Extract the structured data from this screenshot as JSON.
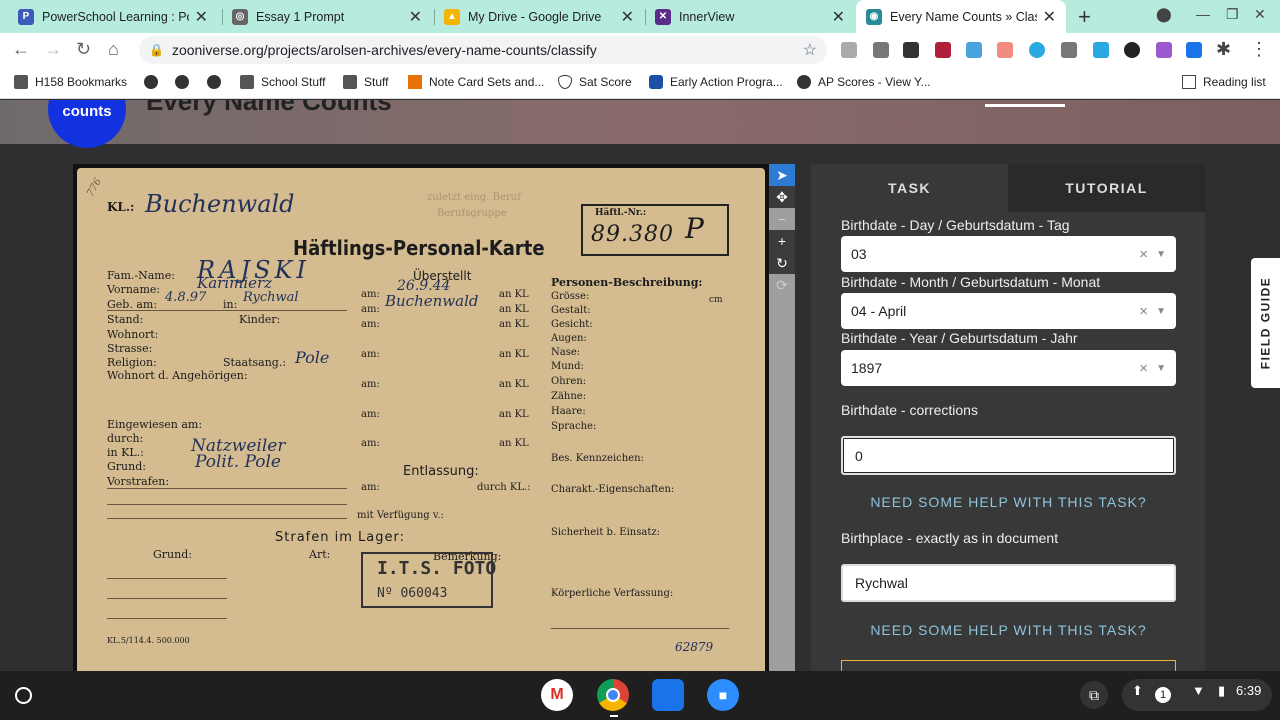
{
  "tabs": [
    {
      "title": "PowerSchool Learning : Port",
      "color": "#3b5bb8",
      "glyph": "P"
    },
    {
      "title": "Essay 1 Prompt",
      "color": "#666",
      "glyph": "◎"
    },
    {
      "title": "My Drive - Google Drive",
      "color": "#f4b400",
      "glyph": "▲"
    },
    {
      "title": "InnerView",
      "color": "#5b2c87",
      "glyph": "✕"
    },
    {
      "title": "Every Name Counts » Classi",
      "color": "#2a8a9a",
      "glyph": "◉"
    }
  ],
  "url": "zooniverse.org/projects/arolsen-archives/every-name-counts/classify",
  "bookmarks": [
    "H158 Bookmarks",
    "",
    "",
    "",
    "School Stuff",
    "Stuff",
    "Note Card Sets and...",
    "Sat Score",
    "Early Action Progra...",
    "AP Scores - View Y..."
  ],
  "reading_list": "Reading list",
  "site": {
    "logo_text": "counts",
    "title": "Every Name Counts"
  },
  "card": {
    "corner": "776",
    "kl_label": "KL.:",
    "kl_value": "Buchenwald",
    "hno_label": "Häftl.-Nr.:",
    "hno_value": "89.380",
    "hno_mark": "P",
    "title": "Häftlings-Personal-Karte",
    "faded_top": "zuletzt eing. Beruf",
    "faded_top2": "Berufsgruppe",
    "ueberstellt": "Überstellt",
    "personen": "Personen-Beschreibung:",
    "fam_label": "Fam.-Name:",
    "fam_value": "RAJSKI",
    "vor_label": "Vorname:",
    "vor_value": "Karimierz",
    "geb_label": "Geb. am:",
    "geb_value": "4.8.97",
    "in_label": "in:",
    "in_value": "Rychwal",
    "stand": "Stand:",
    "kinder": "Kinder:",
    "wohnort": "Wohnort:",
    "strasse": "Strasse:",
    "religion": "Religion:",
    "staatsang": "Staatsang.:",
    "staatsang_value": "Pole",
    "wohnort_ang": "Wohnort d. Angehörigen:",
    "am1_value": "26.9.44",
    "am_kl1_value": "Buchenwald",
    "am": "am:",
    "an_kl": "an KL",
    "groesse": "Grösse:",
    "cm": "cm",
    "gestalt": "Gestalt:",
    "gesicht": "Gesicht:",
    "augen": "Augen:",
    "nase": "Nase:",
    "mund": "Mund:",
    "ohren": "Ohren:",
    "zaehne": "Zähne:",
    "haare": "Haare:",
    "sprache": "Sprache:",
    "eingewiesen": "Eingewiesen am:",
    "durch": "durch:",
    "in_kl": "in KL.:",
    "in_kl_value": "Natzweiler",
    "grund": "Grund:",
    "grund_value": "Polit. Pole",
    "vorstrafen": "Vorstrafen:",
    "entlassung": "Entlassung:",
    "am_e": "am:",
    "durch_kl": "durch KL.:",
    "bes": "Bes. Kennzeichen:",
    "charakt": "Charakt.-Eigenschaften:",
    "verfuegung": "mit Verfügung v.:",
    "strafen": "Strafen im Lager:",
    "grund2": "Grund:",
    "art": "Art:",
    "bemerkung": "Bemerkung:",
    "sicherheit": "Sicherheit b. Einsatz:",
    "koerper": "Körperliche Verfassung:",
    "stamp1": "I.T.S. FOTO",
    "stamp2": "Nº 060043",
    "footer": "KL.5/114.4. 500.000",
    "footer_no": "62879"
  },
  "panel": {
    "tab_task": "TASK",
    "tab_tutorial": "TUTORIAL",
    "day_label": "Birthdate - Day / Geburtsdatum - Tag",
    "day_value": "03",
    "month_label": "Birthdate - Month / Geburtsdatum - Monat",
    "month_value": "04 - April",
    "year_label": "Birthdate - Year / Geburtsdatum - Jahr",
    "year_value": "1897",
    "corr_label": "Birthdate - corrections",
    "corr_value": "0",
    "help1": "NEED SOME HELP WITH THIS TASK?",
    "birthplace_label": "Birthplace - exactly as in document",
    "birthplace_value": "Rychwal",
    "help2": "NEED SOME HELP WITH THIS TASK?"
  },
  "field_guide": "FIELD GUIDE",
  "status": {
    "notifications": "1",
    "time": "6:39"
  }
}
